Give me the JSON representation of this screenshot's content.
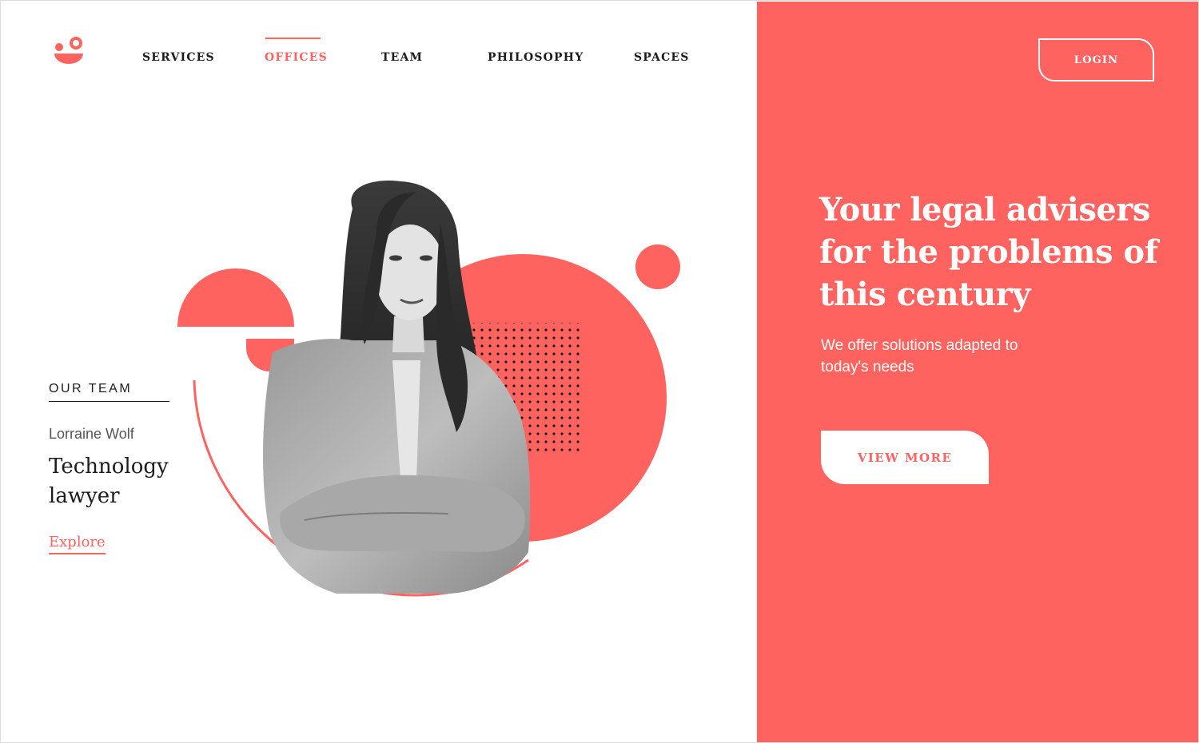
{
  "header": {
    "logo_icon": "brand-logo-icon",
    "nav": [
      {
        "label": "SERVICES",
        "active": false
      },
      {
        "label": "OFFICES",
        "active": true
      },
      {
        "label": "TEAM",
        "active": false
      },
      {
        "label": "PHILOSOPHY",
        "active": false
      },
      {
        "label": "SPACES",
        "active": false
      }
    ],
    "login_label": "LOGIN"
  },
  "hero": {
    "title": "Your legal advisers for the problems of this century",
    "subtitle": "We offer solutions adapted to today's needs",
    "cta_label": "VIEW MORE"
  },
  "team": {
    "section_label": "OUR TEAM",
    "name": "Lorraine Wolf",
    "role": "Technology lawyer",
    "link_label": "Explore"
  },
  "colors": {
    "accent": "#ff6360",
    "text": "#1c1c1c",
    "background": "#ffffff"
  }
}
